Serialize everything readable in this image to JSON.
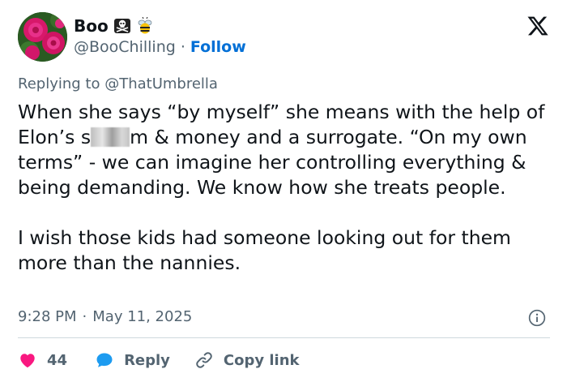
{
  "author": {
    "display_name": "Boo",
    "badges": [
      "skull-crossbones-emoji",
      "bee-emoji"
    ],
    "handle": "@BooChilling",
    "follow_label": "Follow"
  },
  "reply_context": {
    "prefix": "Replying to",
    "mention": "@ThatUmbrella"
  },
  "tweet": {
    "para1_part1": "When she says “by myself” she means with the help of Elon’s s",
    "para1_part2": "m & money and a surrogate. “On my own terms” - we can imagine her controlling everything & being demanding. We know how she treats people.",
    "para2": "I wish those kids had someone looking out for them more than the nannies."
  },
  "meta": {
    "time": "9:28 PM",
    "separator": "·",
    "date": "May 11, 2025"
  },
  "actions": {
    "like_count": "44",
    "reply_label": "Reply",
    "copy_link_label": "Copy link"
  },
  "colors": {
    "text": "#0f1419",
    "secondary": "#536471",
    "link": "#006fd6",
    "like": "#f91880",
    "reply": "#1d9bf0",
    "divider": "#cfd9de"
  },
  "icons": {
    "brand": "x-logo-icon",
    "info": "info-icon",
    "like": "heart-icon",
    "reply": "speech-bubble-icon",
    "copy": "link-icon"
  }
}
